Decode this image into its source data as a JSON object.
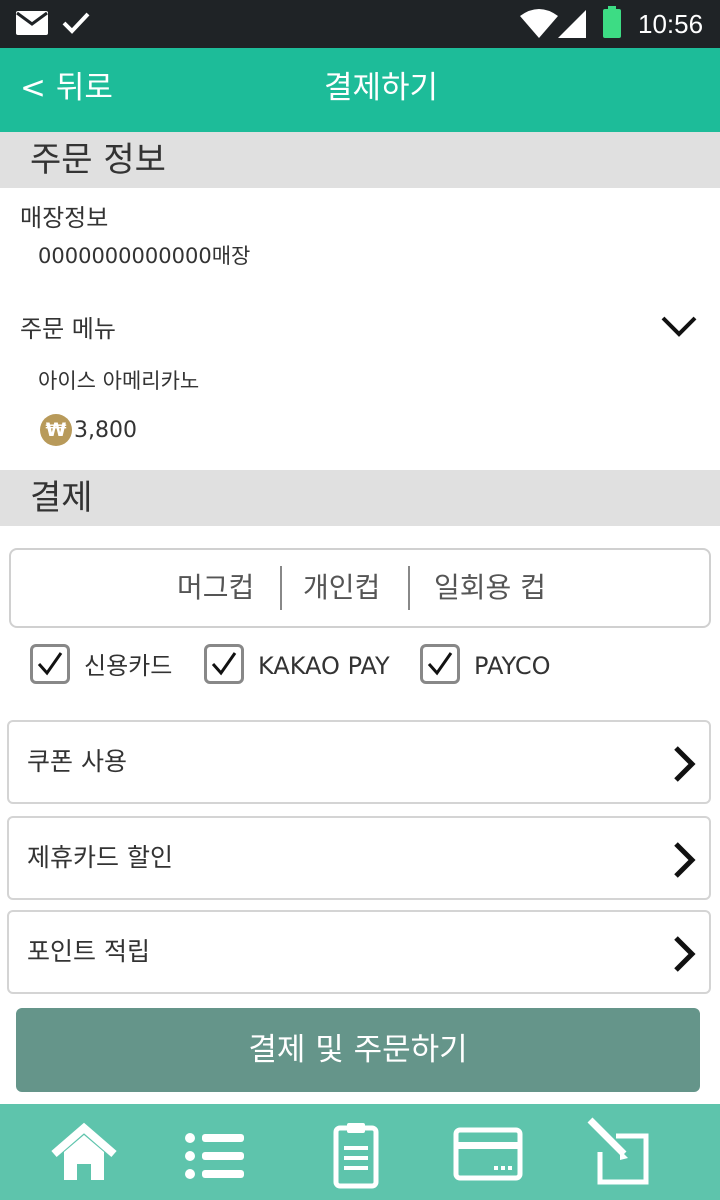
{
  "status_bar": {
    "time": "10:56",
    "icons": [
      "mail-icon",
      "check-icon",
      "wifi-icon",
      "signal-icon",
      "battery-icon"
    ]
  },
  "app_bar": {
    "back_label": "< 뒤로",
    "title": "결제하기"
  },
  "order_section": {
    "title": "주문 정보",
    "store_label": "매장정보",
    "store_value": "0000000000000매장",
    "menu_label": "주문 메뉴",
    "menu_item": "아이스 아메리카노",
    "currency_symbol": "₩",
    "price": "3,800"
  },
  "payment_section": {
    "title": "결제",
    "cup_options": [
      "머그컵",
      "개인컵",
      "일회용 컵"
    ],
    "methods": [
      {
        "label": "신용카드",
        "checked": true
      },
      {
        "label": "KAKAO PAY",
        "checked": true
      },
      {
        "label": "PAYCO",
        "checked": true
      }
    ],
    "rows": [
      {
        "label": "쿠폰 사용"
      },
      {
        "label": "제휴카드 할인"
      },
      {
        "label": "포인트 적립"
      }
    ],
    "submit_label": "결제 및 주문하기"
  },
  "bottom_nav": {
    "items": [
      "home-icon",
      "list-icon",
      "clipboard-icon",
      "card-icon",
      "edit-icon"
    ]
  },
  "colors": {
    "accent": "#1dbc99",
    "nav": "#5ec4ac",
    "submit": "#65958a",
    "section": "#e0e0e0",
    "coin": "#b89a5a"
  }
}
